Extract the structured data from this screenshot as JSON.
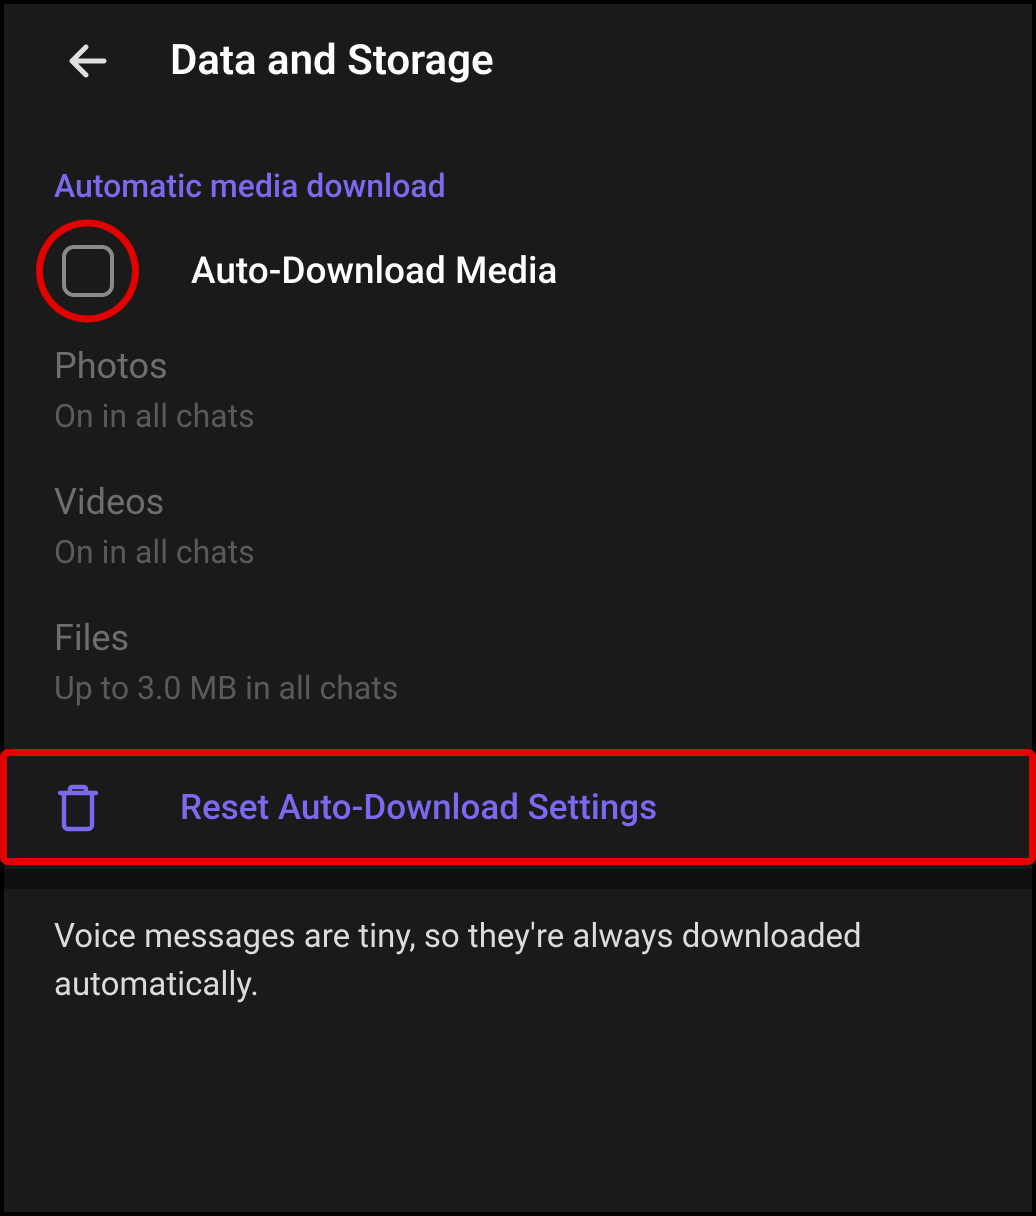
{
  "header": {
    "title": "Data and Storage"
  },
  "section": {
    "title": "Automatic media download"
  },
  "checkbox": {
    "label": "Auto-Download Media",
    "checked": false
  },
  "settings": [
    {
      "title": "Photos",
      "subtitle": "On in all chats"
    },
    {
      "title": "Videos",
      "subtitle": "On in all chats"
    },
    {
      "title": "Files",
      "subtitle": "Up to 3.0 MB in all chats"
    }
  ],
  "reset": {
    "label": "Reset Auto-Download Settings"
  },
  "footer": {
    "note": "Voice messages are tiny, so they're always downloaded automatically."
  },
  "colors": {
    "accent": "#7b6af0",
    "highlight": "#e30000",
    "background": "#1a1a1a"
  }
}
